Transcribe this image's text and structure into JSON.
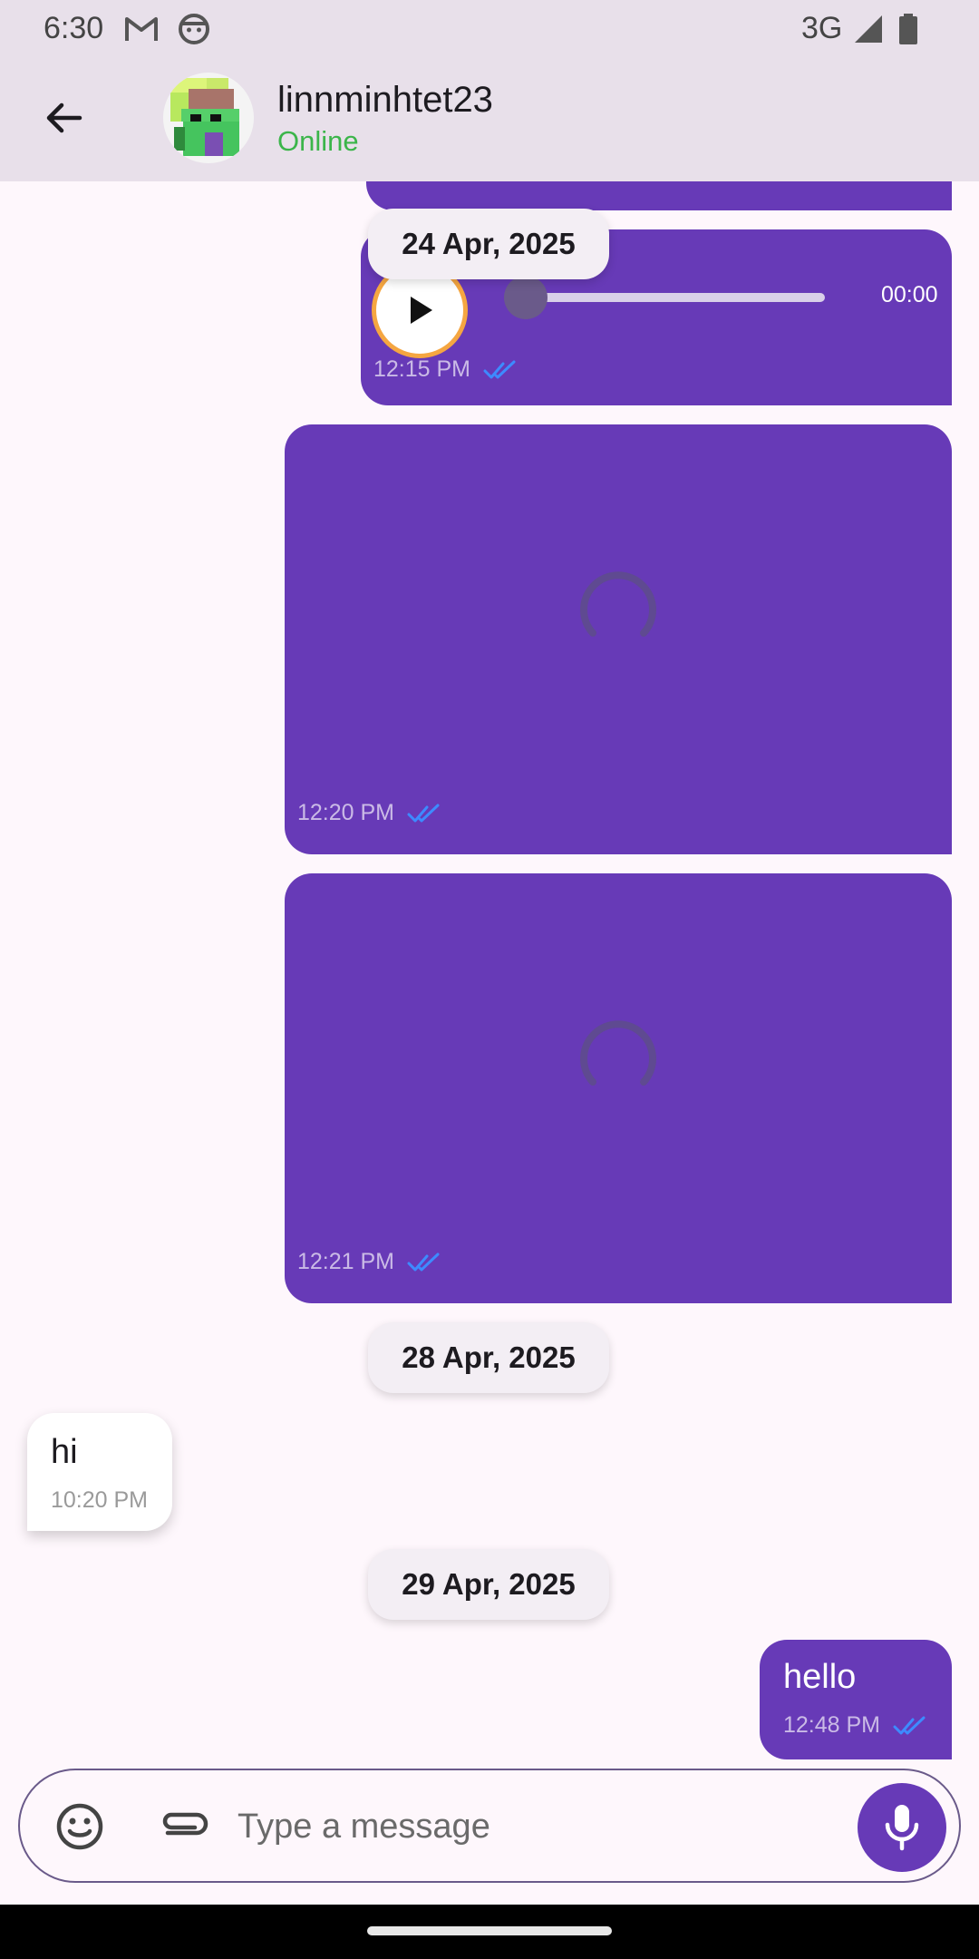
{
  "status_bar": {
    "time": "6:30",
    "network": "3G",
    "icons": [
      "gmail-icon",
      "android-face-icon",
      "signal-icon",
      "battery-icon"
    ]
  },
  "header": {
    "contact_name": "linnminhtet23",
    "contact_status": "Online",
    "back_icon": "arrow-back-icon"
  },
  "messages": [
    {
      "type": "voice",
      "direction": "outgoing",
      "duration": "00:00",
      "time": "12:15 PM",
      "read": true
    },
    {
      "type": "image-loading",
      "direction": "outgoing",
      "time": "12:20 PM",
      "read": true
    },
    {
      "type": "image-loading",
      "direction": "outgoing",
      "time": "12:21 PM",
      "read": true
    },
    {
      "type": "text",
      "direction": "incoming",
      "text": "hi",
      "time": "10:20 PM"
    },
    {
      "type": "text",
      "direction": "outgoing",
      "text": "hello",
      "time": "12:48 PM",
      "read": true
    }
  ],
  "date_separators": [
    "24 Apr, 2025",
    "28 Apr, 2025",
    "29 Apr, 2025"
  ],
  "composer": {
    "placeholder": "Type a message",
    "value": ""
  },
  "colors": {
    "accent": "#673ab7",
    "online": "#3bb54a",
    "read_tick": "#3d8bff",
    "play_ring": "#f5a641",
    "header_bg": "#e8e0ea",
    "chat_bg": "#fef7fc"
  }
}
